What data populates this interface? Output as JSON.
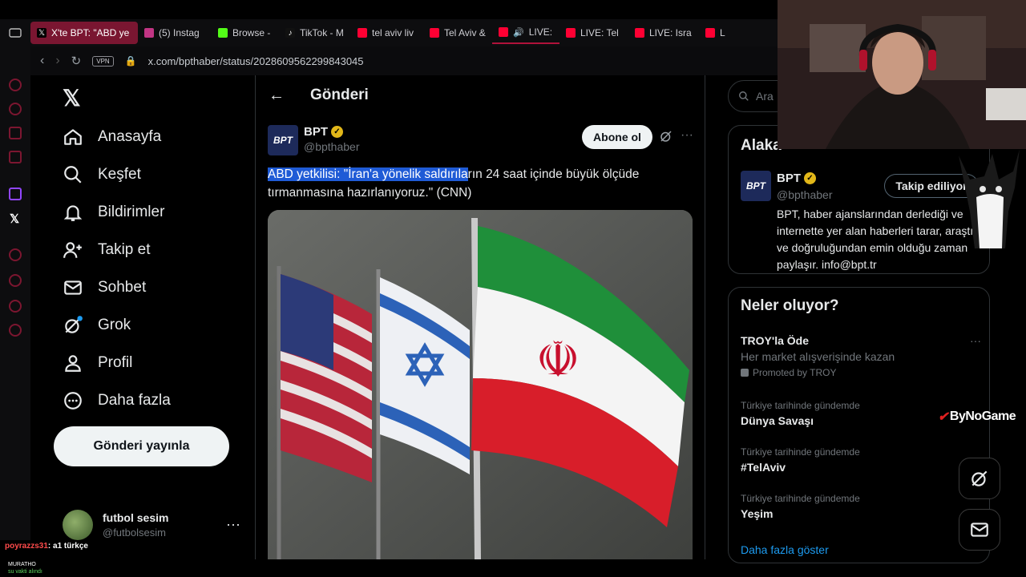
{
  "browser": {
    "tabs": [
      {
        "label": "X'te BPT: \"ABD ye",
        "color": "#000000",
        "active": true
      },
      {
        "label": "(5) Instag",
        "color": "#c13584"
      },
      {
        "label": "Browse -",
        "color": "#53fc18"
      },
      {
        "label": "TikTok - M",
        "color": "#ffffff"
      },
      {
        "label": "tel aviv liv",
        "color": "#ff0033"
      },
      {
        "label": "Tel Aviv &",
        "color": "#ff0033"
      },
      {
        "label": "LIVE:",
        "color": "#ff0033"
      },
      {
        "label": "LIVE: Tel",
        "color": "#ff0033"
      },
      {
        "label": "LIVE: Isra",
        "color": "#ff0033"
      },
      {
        "label": "L",
        "color": "#ff0033"
      }
    ],
    "vpn_label": "VPN",
    "url": "x.com/bpthaber/status/2028609562299843045"
  },
  "nav": {
    "items": [
      {
        "label": "Anasayfa",
        "icon": "home-icon"
      },
      {
        "label": "Keşfet",
        "icon": "search-icon"
      },
      {
        "label": "Bildirimler",
        "icon": "bell-icon"
      },
      {
        "label": "Takip et",
        "icon": "follow-icon"
      },
      {
        "label": "Sohbet",
        "icon": "mail-icon"
      },
      {
        "label": "Grok",
        "icon": "grok-icon"
      },
      {
        "label": "Profil",
        "icon": "profile-icon"
      },
      {
        "label": "Daha fazla",
        "icon": "more-icon"
      }
    ],
    "post_button": "Gönderi yayınla",
    "account": {
      "name": "futbol sesim",
      "handle": "@futbolsesim"
    }
  },
  "main": {
    "title": "Gönderi",
    "tweet": {
      "avatar_text": "BPT",
      "name": "BPT",
      "handle": "@bpthaber",
      "subscribe": "Abone ol",
      "text_highlight": "ABD yetkilisi: \"İran'a yönelik saldırıla",
      "text_rest": "rın 24 saat içinde büyük ölçüde tırmanmasına hazırlanıyoruz.\" (CNN)"
    }
  },
  "right": {
    "search_placeholder": "Ara",
    "relevant": {
      "title": "Alaka",
      "name": "BPT",
      "handle": "@bpthaber",
      "follow_state": "Takip ediliyor",
      "bio": "BPT, haber ajanslarından derlediği ve internette yer alan haberleri tarar, araştırır ve doğruluğundan emin olduğu zaman paylaşır. info@bpt.tr"
    },
    "whats_happening": {
      "title": "Neler oluyor?",
      "promo": {
        "title": "TROY'la Öde",
        "sub": "Her market alışverişinde kazan",
        "promoted": "Promoted by TROY"
      },
      "trends": [
        {
          "context": "Türkiye tarihinde gündemde",
          "name": "Dünya Savaşı"
        },
        {
          "context": "Türkiye tarihinde gündemde",
          "name": "#TelAviv"
        },
        {
          "context": "Türkiye tarihinde gündemde",
          "name": "Yeşim"
        }
      ],
      "show_more": "Daha fazla göster"
    }
  },
  "overlay": {
    "brand": "ByNoGame",
    "chat_user": "poyrazzs31",
    "chat_message": ": a1 türkçe",
    "mini_user": "MURATHO",
    "mini_sub": "su vakti alındı"
  },
  "colors": {
    "accent": "#1d9bf0",
    "highlight": "#1f5bd6",
    "opera": "#7c1630"
  }
}
